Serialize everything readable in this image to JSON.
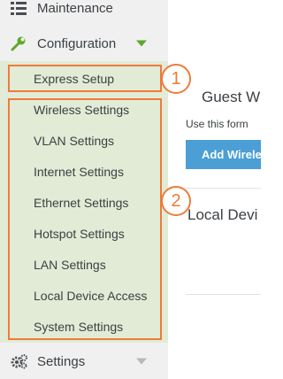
{
  "sidebar": {
    "maintenance_label": "Maintenance",
    "configuration_label": "Configuration",
    "settings_label": "Settings",
    "submenu": [
      "Express Setup",
      "Wireless Settings",
      "VLAN Settings",
      "Internet Settings",
      "Ethernet Settings",
      "Hotspot Settings",
      "LAN Settings",
      "Local Device Access",
      "System Settings"
    ]
  },
  "annotations": {
    "badge1": "1",
    "badge2": "2"
  },
  "main": {
    "title": "Guest Wire",
    "description": "Use this form",
    "button_label": "Add Wirele",
    "heading2": "Local Devi"
  },
  "colors": {
    "accent_green": "#5fa82c",
    "highlight_orange": "#ee7b3a",
    "button_blue": "#4b9fd5",
    "submenu_bg": "#e2ebd6"
  }
}
